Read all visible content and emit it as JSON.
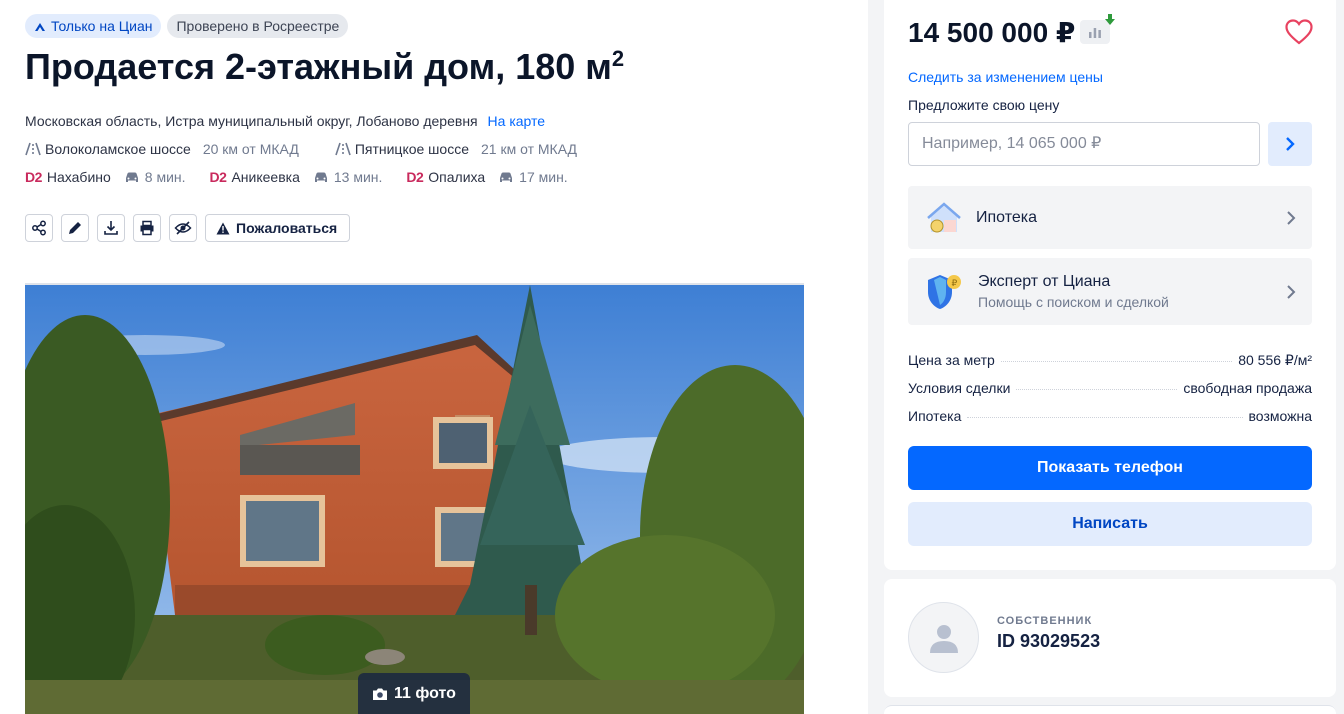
{
  "badges": {
    "only_cian": "Только на Циан",
    "verified": "Проверено в Росреестре"
  },
  "listing": {
    "title": "Продается 2-этажный дом, 180 м",
    "title_sup": "2",
    "address": "Московская область, Истра муниципальный округ, Лобаново деревня",
    "map_link": "На карте"
  },
  "highways": [
    {
      "name": "Волоколамское шоссе",
      "distance": "20 км от МКАД"
    },
    {
      "name": "Пятницкое шоссе",
      "distance": "21 км от МКАД"
    }
  ],
  "stations": [
    {
      "line": "D2",
      "name": "Нахабино",
      "time": "8 мин."
    },
    {
      "line": "D2",
      "name": "Аникеевка",
      "time": "13 мин."
    },
    {
      "line": "D2",
      "name": "Опалиха",
      "time": "17 мин."
    }
  ],
  "actions": {
    "complain": "Пожаловаться"
  },
  "gallery": {
    "count_label": "11 фото"
  },
  "sidebar": {
    "price": "14 500 000 ₽",
    "follow_price": "Следить за изменением цены",
    "offer_label": "Предложите свою цену",
    "offer_placeholder": "Например, 14 065 000 ₽",
    "mortgage_tile": "Ипотека",
    "expert_title": "Эксперт от Циана",
    "expert_sub": "Помощь с поиском и сделкой",
    "facts": [
      {
        "label": "Цена за метр",
        "value": "80 556 ₽/м²"
      },
      {
        "label": "Условия сделки",
        "value": "свободная продажа"
      },
      {
        "label": "Ипотека",
        "value": "возможна"
      }
    ],
    "show_phone": "Показать телефон",
    "write": "Написать"
  },
  "owner": {
    "type": "СОБСТВЕННИК",
    "id": "ID 93029523"
  },
  "colors": {
    "accent": "#0468ff",
    "accent_light": "#e2ecfd",
    "metro_d2": "#c92a5d",
    "heart": "#e84260"
  }
}
